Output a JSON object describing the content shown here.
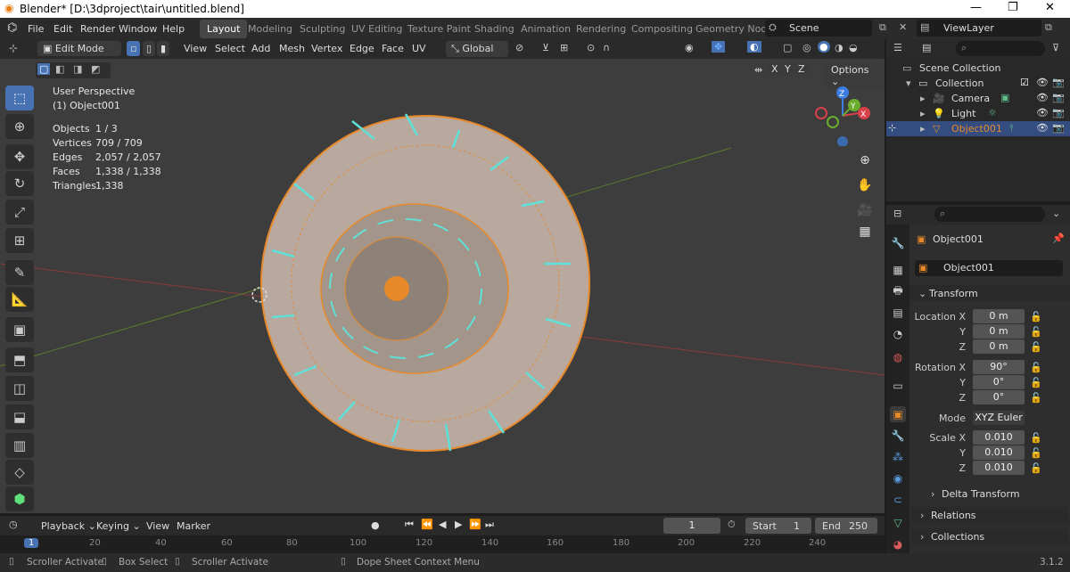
{
  "title": "Blender* [D:\\3dproject\\tair\\untitled.blend]",
  "window_controls": {
    "min": "—",
    "max": "❐",
    "close": "✕"
  },
  "menu": {
    "file": "File",
    "edit": "Edit",
    "render": "Render",
    "window": "Window",
    "help": "Help"
  },
  "workspaces": [
    "Layout",
    "Modeling",
    "Sculpting",
    "UV Editing",
    "Texture Paint",
    "Shading",
    "Animation",
    "Rendering",
    "Compositing",
    "Geometry Nod"
  ],
  "scene": "Scene",
  "view_layer": "ViewLayer",
  "header": {
    "mode": "Edit Mode",
    "view": "View",
    "select": "Select",
    "add": "Add",
    "mesh": "Mesh",
    "vertex": "Vertex",
    "edge": "Edge",
    "face": "Face",
    "uv": "UV",
    "orientation": "Global",
    "options": "Options",
    "x": "X",
    "y": "Y",
    "z": "Z"
  },
  "overlay": {
    "perspective": "User Perspective",
    "object": "(1) Object001",
    "stats": [
      {
        "label": "Objects",
        "value": "1 / 3"
      },
      {
        "label": "Vertices",
        "value": "709 / 709"
      },
      {
        "label": "Edges",
        "value": "2,057 / 2,057"
      },
      {
        "label": "Faces",
        "value": "1,338 / 1,338"
      },
      {
        "label": "Triangles",
        "value": "1,338"
      }
    ]
  },
  "gizmo": {
    "x": "X",
    "y": "Y",
    "z": "Z"
  },
  "outliner": {
    "scene_collection": "Scene Collection",
    "collection": "Collection",
    "items": [
      {
        "name": "Camera"
      },
      {
        "name": "Light"
      },
      {
        "name": "Object001"
      }
    ]
  },
  "properties": {
    "object_name": "Object001",
    "data_name": "Object001",
    "transform": "Transform",
    "location_x_label": "Location X",
    "location_x": "0 m",
    "location_y_label": "Y",
    "location_y": "0 m",
    "location_z_label": "Z",
    "location_z": "0 m",
    "rotation_x_label": "Rotation X",
    "rotation_x": "90°",
    "rotation_y_label": "Y",
    "rotation_y": "0°",
    "rotation_z_label": "Z",
    "rotation_z": "0°",
    "mode_label": "Mode",
    "mode": "XYZ Euler",
    "scale_x_label": "Scale X",
    "scale_x": "0.010",
    "scale_y_label": "Y",
    "scale_y": "0.010",
    "scale_z_label": "Z",
    "scale_z": "0.010",
    "delta": "Delta Transform",
    "relations": "Relations",
    "collections": "Collections"
  },
  "timeline": {
    "playback": "Playback",
    "keying": "Keying",
    "view": "View",
    "marker": "Marker",
    "frame": "1",
    "start_label": "Start",
    "start": "1",
    "end_label": "End",
    "end": "250",
    "ticks": [
      "1",
      "20",
      "40",
      "60",
      "80",
      "100",
      "120",
      "140",
      "160",
      "180",
      "200",
      "220",
      "240"
    ]
  },
  "status": {
    "s1": "Scroller Activate",
    "s2": "Box Select",
    "s3": "Scroller Activate",
    "s4": "Dope Sheet Context Menu",
    "version": "3.1.2"
  }
}
